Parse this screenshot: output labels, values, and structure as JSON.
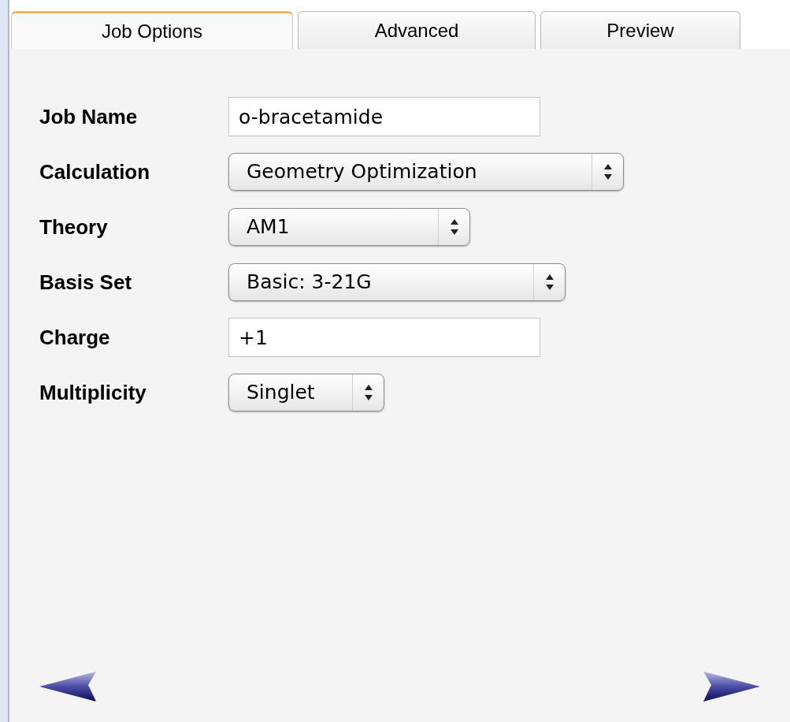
{
  "tabs": [
    {
      "label": "Job Options",
      "selected": true
    },
    {
      "label": "Advanced",
      "selected": false
    },
    {
      "label": "Preview",
      "selected": false
    }
  ],
  "fields": [
    {
      "label": "Job Name",
      "kind": "text",
      "value": "o-bracetamide"
    },
    {
      "label": "Calculation",
      "kind": "select",
      "value": "Geometry Optimization"
    },
    {
      "label": "Theory",
      "kind": "select",
      "value": "AM1"
    },
    {
      "label": "Basis Set",
      "kind": "select",
      "value": "Basic: 3-21G"
    },
    {
      "label": "Charge",
      "kind": "text",
      "value": "+1"
    },
    {
      "label": "Multiplicity",
      "kind": "select",
      "value": "Singlet"
    }
  ]
}
